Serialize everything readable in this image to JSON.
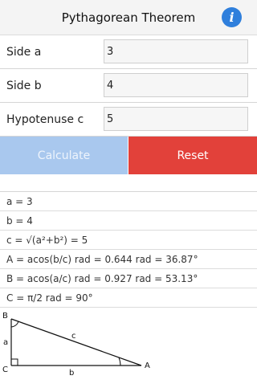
{
  "header": {
    "title": "Pythagorean Theorem",
    "info_icon": "info-icon",
    "info_glyph": "i"
  },
  "fields": [
    {
      "label": "Side a",
      "value": "3"
    },
    {
      "label": "Side b",
      "value": "4"
    },
    {
      "label": "Hypotenuse c",
      "value": "5"
    }
  ],
  "buttons": {
    "calculate": "Calculate",
    "reset": "Reset"
  },
  "colors": {
    "calculate_bg": "#a9c8ee",
    "reset_bg": "#e2413a",
    "info_bg": "#2f7fdc"
  },
  "results": [
    "a = 3",
    "b = 4",
    "c = √(a²+b²) = 5",
    "A = acos(b/c) rad = 0.644 rad = 36.87°",
    "B = acos(a/c) rad = 0.927 rad = 53.13°",
    "C = π/2 rad = 90°"
  ],
  "diagram": {
    "vertex_A": "A",
    "vertex_B": "B",
    "vertex_C": "C",
    "side_a": "a",
    "side_b": "b",
    "side_c": "c"
  }
}
